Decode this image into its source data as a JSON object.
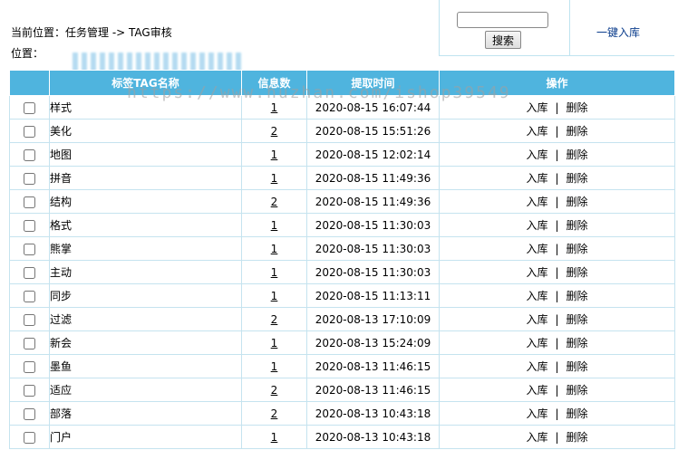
{
  "header": {
    "breadcrumb": "当前位置：任务管理 -> TAG审核",
    "position_label": "位置：",
    "search_placeholder": "",
    "search_button": "搜索",
    "onekey_link": "一键入库"
  },
  "table": {
    "columns": [
      "",
      "标签TAG名称",
      "信息数",
      "提取时间",
      "操作"
    ],
    "rows": [
      {
        "name": "样式",
        "count": "1",
        "time": "2020-08-15 16:07:44"
      },
      {
        "name": "美化",
        "count": "2",
        "time": "2020-08-15 15:51:26"
      },
      {
        "name": "地图",
        "count": "1",
        "time": "2020-08-15 12:02:14"
      },
      {
        "name": "拼音",
        "count": "1",
        "time": "2020-08-15 11:49:36"
      },
      {
        "name": "结构",
        "count": "2",
        "time": "2020-08-15 11:49:36"
      },
      {
        "name": "格式",
        "count": "1",
        "time": "2020-08-15 11:30:03"
      },
      {
        "name": "熊掌",
        "count": "1",
        "time": "2020-08-15 11:30:03"
      },
      {
        "name": "主动",
        "count": "1",
        "time": "2020-08-15 11:30:03"
      },
      {
        "name": "同步",
        "count": "1",
        "time": "2020-08-15 11:13:11"
      },
      {
        "name": "过滤",
        "count": "2",
        "time": "2020-08-13 17:10:09"
      },
      {
        "name": "新会",
        "count": "1",
        "time": "2020-08-13 15:24:09"
      },
      {
        "name": "墨鱼",
        "count": "1",
        "time": "2020-08-13 11:46:15"
      },
      {
        "name": "适应",
        "count": "2",
        "time": "2020-08-13 11:46:15"
      },
      {
        "name": "部落",
        "count": "2",
        "time": "2020-08-13 10:43:18"
      },
      {
        "name": "门户",
        "count": "1",
        "time": "2020-08-13 10:43:18"
      }
    ],
    "action_import": "入库",
    "action_separator": "|",
    "action_delete": "删除"
  },
  "watermark": "https://www.huzhan.com/ishop39549",
  "colors": {
    "header_bg": "#4fb4de",
    "border": "#c5e3ef",
    "link": "#0a3c8c"
  }
}
